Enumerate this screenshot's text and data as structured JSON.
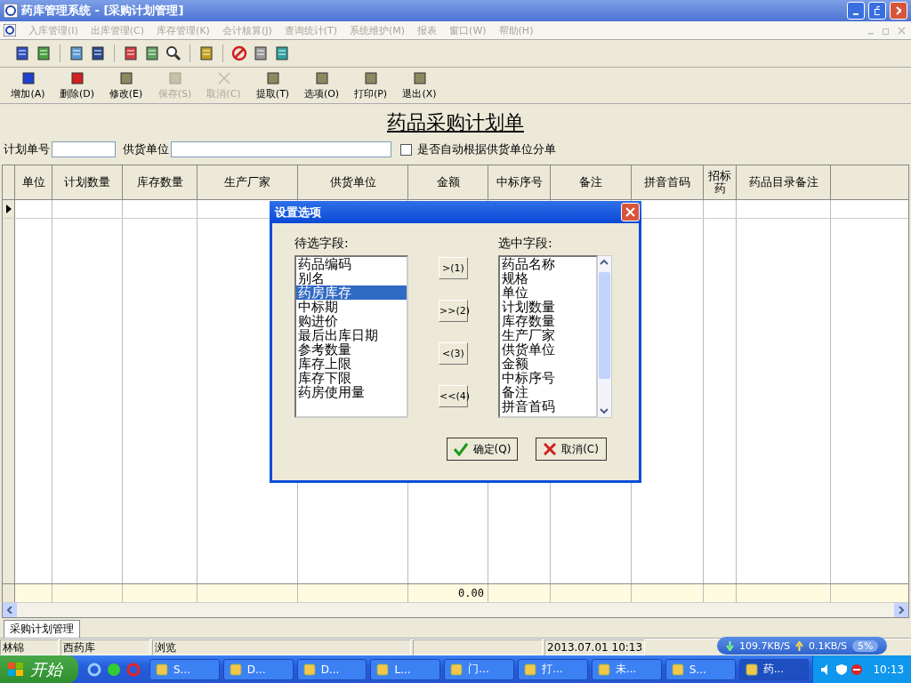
{
  "window": {
    "title": "药库管理系统 - [采购计划管理]"
  },
  "menu": [
    {
      "label": "入库管理(I)",
      "disabled": true
    },
    {
      "label": "出库管理(C)",
      "disabled": true
    },
    {
      "label": "库存管理(K)",
      "disabled": true
    },
    {
      "label": "会计核算(J)",
      "disabled": true
    },
    {
      "label": "查询统计(T)",
      "disabled": true
    },
    {
      "label": "系统维护(M)",
      "disabled": true
    },
    {
      "label": "报表",
      "disabled": true
    },
    {
      "label": "窗口(W)",
      "disabled": true
    },
    {
      "label": "帮助(H)",
      "disabled": true
    }
  ],
  "toolbar": [
    {
      "label": "增加(A)",
      "disabled": false
    },
    {
      "label": "删除(D)",
      "disabled": false
    },
    {
      "label": "修改(E)",
      "disabled": false
    },
    {
      "label": "保存(S)",
      "disabled": true
    },
    {
      "label": "取消(C)",
      "disabled": true
    },
    {
      "label": "提取(T)",
      "disabled": false
    },
    {
      "label": "选项(O)",
      "disabled": false
    },
    {
      "label": "打印(P)",
      "disabled": false
    },
    {
      "label": "退出(X)",
      "disabled": false
    }
  ],
  "form": {
    "title": "药品采购计划单",
    "plan_no_label": "计划单号",
    "supplier_label": "供货单位",
    "auto_split": {
      "label": "是否自动根据供货单位分单",
      "checked": false
    }
  },
  "table": {
    "columns": [
      "单位",
      "计划数量",
      "库存数量",
      "生产厂家",
      "供货单位",
      "金额",
      "中标序号",
      "备注",
      "拼音首码",
      "招标药",
      "药品目录备注"
    ],
    "total_amount": "0.00"
  },
  "bottom_tabs": [
    {
      "label": "采购计划管理",
      "selected": true
    }
  ],
  "status_bar": [
    "林锦",
    "西药库",
    "浏览",
    "2013.07.01 10:13"
  ],
  "net_monitor": {
    "download": "109.7KB/S",
    "upload": "0.1KB/S",
    "usage": "5%"
  },
  "taskbar": {
    "start": "开始",
    "tasks": [
      {
        "label": "S...",
        "selected": false
      },
      {
        "label": "D...",
        "selected": false
      },
      {
        "label": "D...",
        "selected": false
      },
      {
        "label": "L...",
        "selected": false
      },
      {
        "label": "门...",
        "selected": false
      },
      {
        "label": "打...",
        "selected": false
      },
      {
        "label": "未...",
        "selected": false
      },
      {
        "label": "S...",
        "selected": false
      },
      {
        "label": "药...",
        "selected": true
      }
    ],
    "clock": "10:13"
  },
  "dialog": {
    "title": "设置选项",
    "available_label": "待选字段:",
    "available": [
      {
        "label": "药品编码",
        "selected": false
      },
      {
        "label": "别名",
        "selected": false
      },
      {
        "label": "药房库存",
        "selected": true
      },
      {
        "label": "中标期",
        "selected": false
      },
      {
        "label": "购进价",
        "selected": false
      },
      {
        "label": "最后出库日期",
        "selected": false
      },
      {
        "label": "参考数量",
        "selected": false
      },
      {
        "label": "库存上限",
        "selected": false
      },
      {
        "label": "库存下限",
        "selected": false
      },
      {
        "label": "药房使用量",
        "selected": false
      }
    ],
    "chosen_label": "选中字段:",
    "chosen": [
      "药品名称",
      "规格",
      "单位",
      "计划数量",
      "库存数量",
      "生产厂家",
      "供货单位",
      "金额",
      "中标序号",
      "备注",
      "拼音首码"
    ],
    "move_buttons": [
      ">(1)",
      ">>(2)",
      "<(3)",
      "<<(4)"
    ],
    "ok": "确定(Q)",
    "cancel": "取消(C)"
  }
}
